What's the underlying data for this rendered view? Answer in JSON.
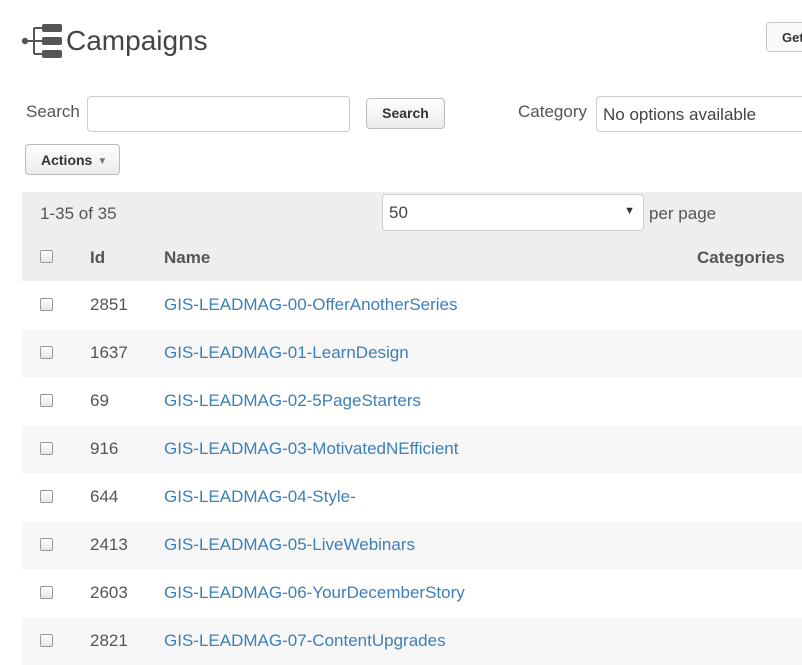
{
  "header": {
    "title": "Campaigns",
    "icon": "campaign-tree-icon",
    "get_button_label": "Get"
  },
  "filters": {
    "search_label": "Search",
    "search_value": "",
    "search_button_label": "Search",
    "category_label": "Category",
    "category_value": "No options available",
    "actions_label": "Actions"
  },
  "grid": {
    "range_text": "1-35 of 35",
    "per_page_value": "50",
    "per_page_label": "per page",
    "columns": [
      "Id",
      "Name",
      "Categories"
    ],
    "rows": [
      {
        "id": "2851",
        "name": "GIS-LEADMAG-00-OfferAnotherSeries"
      },
      {
        "id": "1637",
        "name": "GIS-LEADMAG-01-LearnDesign"
      },
      {
        "id": "69",
        "name": "GIS-LEADMAG-02-5PageStarters"
      },
      {
        "id": "916",
        "name": "GIS-LEADMAG-03-MotivatedNEfficient"
      },
      {
        "id": "644",
        "name": "GIS-LEADMAG-04-Style-"
      },
      {
        "id": "2413",
        "name": "GIS-LEADMAG-05-LiveWebinars"
      },
      {
        "id": "2603",
        "name": "GIS-LEADMAG-06-YourDecemberStory"
      },
      {
        "id": "2821",
        "name": "GIS-LEADMAG-07-ContentUpgrades"
      }
    ]
  },
  "colors": {
    "link": "#3d7fb8",
    "header_bg": "#eeeeee",
    "stripe_bg": "#f7f7f7",
    "text": "#555555"
  }
}
